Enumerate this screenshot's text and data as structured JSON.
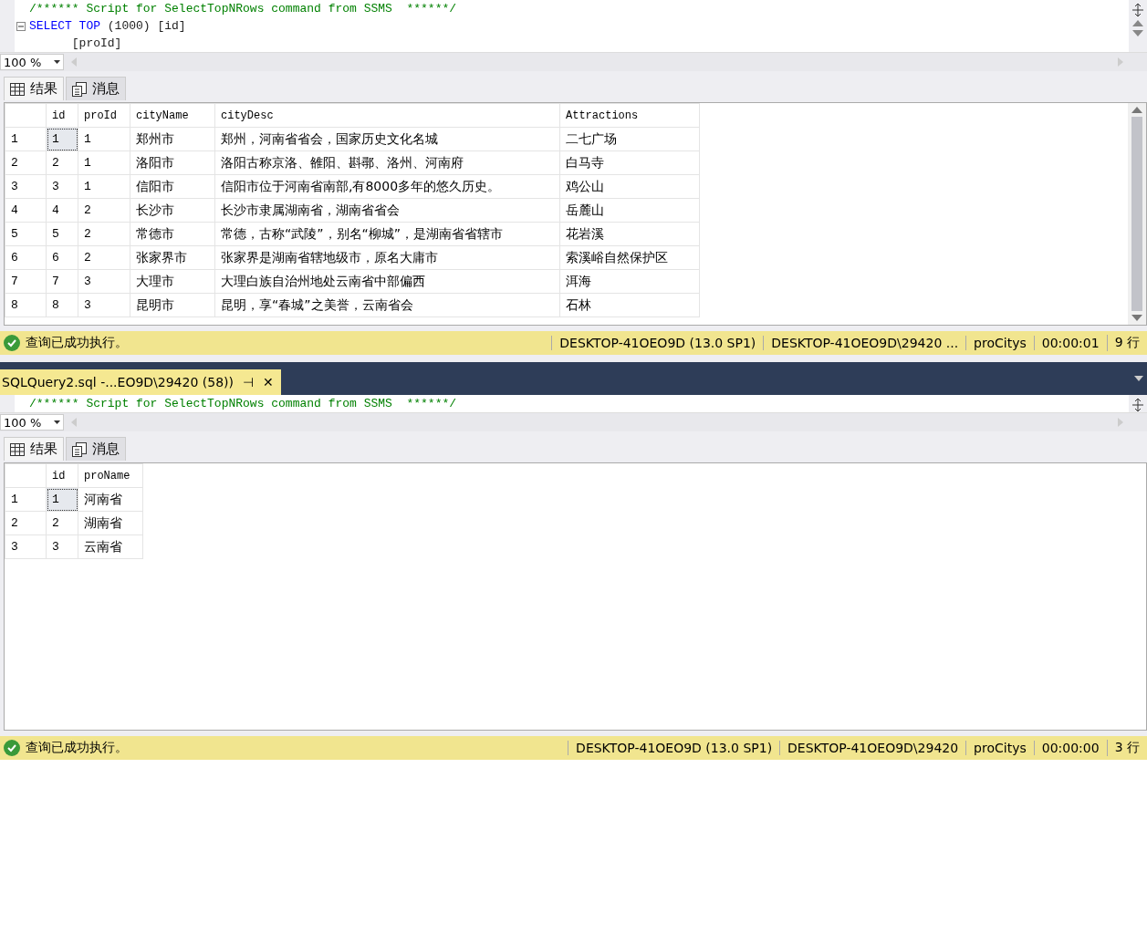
{
  "panes": [
    {
      "editor": {
        "lines": [
          {
            "foldable": false,
            "tokens": [
              {
                "kind": "comment",
                "text": "/****** Script for SelectTopNRows command from SSMS  ******/"
              }
            ]
          },
          {
            "foldable": true,
            "tokens": [
              {
                "kind": "keyword",
                "text": "SELECT TOP"
              },
              {
                "kind": "plain",
                "text": " (1000) [id]"
              }
            ]
          },
          {
            "foldable": false,
            "tokens": [
              {
                "kind": "plain",
                "text": "      [proId]"
              }
            ]
          }
        ]
      },
      "zoom": "100 %",
      "result_tabs": [
        {
          "label": "结果",
          "kind": "grid",
          "selected": true
        },
        {
          "label": "消息",
          "kind": "messages",
          "selected": false
        }
      ],
      "grid": {
        "columns": [
          "id",
          "proId",
          "cityName",
          "cityDesc",
          "Attractions"
        ],
        "rows": [
          {
            "row_number": "1",
            "cells": [
              {
                "text": "1",
                "selected": true
              },
              {
                "text": "1",
                "selected": false
              },
              {
                "text": "郑州市",
                "selected": false
              },
              {
                "text": "郑州，河南省省会，国家历史文化名城",
                "selected": false
              },
              {
                "text": "二七广场",
                "selected": false
              }
            ]
          },
          {
            "row_number": "2",
            "cells": [
              {
                "text": "2",
                "selected": false
              },
              {
                "text": "1",
                "selected": false
              },
              {
                "text": "洛阳市",
                "selected": false
              },
              {
                "text": "洛阳古称京洛、雒阳、斟鄩、洛州、河南府",
                "selected": false
              },
              {
                "text": "白马寺",
                "selected": false
              }
            ]
          },
          {
            "row_number": "3",
            "cells": [
              {
                "text": "3",
                "selected": false
              },
              {
                "text": "1",
                "selected": false
              },
              {
                "text": "信阳市",
                "selected": false
              },
              {
                "text": "信阳市位于河南省南部,有8000多年的悠久历史。",
                "selected": false
              },
              {
                "text": "鸡公山",
                "selected": false
              }
            ]
          },
          {
            "row_number": "4",
            "cells": [
              {
                "text": "4",
                "selected": false
              },
              {
                "text": "2",
                "selected": false
              },
              {
                "text": "长沙市",
                "selected": false
              },
              {
                "text": "长沙市隶属湖南省，湖南省省会",
                "selected": false
              },
              {
                "text": "岳麓山",
                "selected": false
              }
            ]
          },
          {
            "row_number": "5",
            "cells": [
              {
                "text": "5",
                "selected": false
              },
              {
                "text": "2",
                "selected": false
              },
              {
                "text": "常德市",
                "selected": false
              },
              {
                "text": "常德，古称“武陵”，别名“柳城”，是湖南省省辖市",
                "selected": false
              },
              {
                "text": "花岩溪",
                "selected": false
              }
            ]
          },
          {
            "row_number": "6",
            "cells": [
              {
                "text": "6",
                "selected": false
              },
              {
                "text": "2",
                "selected": false
              },
              {
                "text": "张家界市",
                "selected": false
              },
              {
                "text": "张家界是湖南省辖地级市，原名大庸市",
                "selected": false
              },
              {
                "text": "索溪峪自然保护区",
                "selected": false
              }
            ]
          },
          {
            "row_number": "7",
            "cells": [
              {
                "text": "7",
                "selected": false
              },
              {
                "text": "3",
                "selected": false
              },
              {
                "text": "大理市",
                "selected": false
              },
              {
                "text": "大理白族自治州地处云南省中部偏西",
                "selected": false
              },
              {
                "text": "洱海",
                "selected": false
              }
            ]
          },
          {
            "row_number": "8",
            "cells": [
              {
                "text": "8",
                "selected": false
              },
              {
                "text": "3",
                "selected": false
              },
              {
                "text": "昆明市",
                "selected": false
              },
              {
                "text": "昆明，享“春城”之美誉，云南省会",
                "selected": false
              },
              {
                "text": "石林",
                "selected": false
              }
            ]
          }
        ]
      },
      "status": {
        "message": "查询已成功执行。",
        "items": [
          "DESKTOP-41OEO9D (13.0 SP1)",
          "DESKTOP-41OEO9D\\29420 ...",
          "proCitys",
          "00:00:01",
          "9 行"
        ]
      }
    },
    {
      "document_tab": {
        "title": "SQLQuery2.sql -...EO9D\\29420 (58))",
        "pin": "⊣",
        "close": "✕"
      },
      "editor": {
        "lines": [
          {
            "foldable": false,
            "tokens": [
              {
                "kind": "comment",
                "text": "/****** Script for SelectTopNRows command from SSMS  ******/"
              }
            ]
          }
        ]
      },
      "zoom": "100 %",
      "result_tabs": [
        {
          "label": "结果",
          "kind": "grid",
          "selected": true
        },
        {
          "label": "消息",
          "kind": "messages",
          "selected": false
        }
      ],
      "grid": {
        "columns": [
          "id",
          "proName"
        ],
        "rows": [
          {
            "row_number": "1",
            "cells": [
              {
                "text": "1",
                "selected": true
              },
              {
                "text": "河南省",
                "selected": false
              }
            ]
          },
          {
            "row_number": "2",
            "cells": [
              {
                "text": "2",
                "selected": false
              },
              {
                "text": "湖南省",
                "selected": false
              }
            ]
          },
          {
            "row_number": "3",
            "cells": [
              {
                "text": "3",
                "selected": false
              },
              {
                "text": "云南省",
                "selected": false
              }
            ]
          }
        ]
      },
      "status": {
        "message": "查询已成功执行。",
        "items": [
          "DESKTOP-41OEO9D (13.0 SP1)",
          "DESKTOP-41OEO9D\\29420",
          "proCitys",
          "00:00:00",
          "3 行"
        ]
      }
    }
  ]
}
